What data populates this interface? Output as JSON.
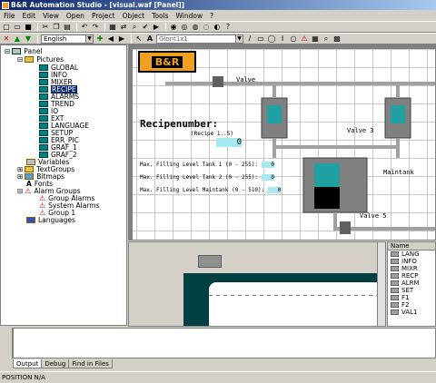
{
  "window": {
    "title": "B&R Automation Studio - [visual.waf [Panel]]"
  },
  "menu": [
    "File",
    "Edit",
    "View",
    "Open",
    "Project",
    "Object",
    "Tools",
    "Window",
    "?"
  ],
  "toolbar2": {
    "language": "English",
    "font": "Glont1x1"
  },
  "tree": {
    "root": "Panel",
    "pictures_label": "Pictures",
    "pictures": [
      "GLOBAL",
      "INFO",
      "MIXER",
      "RECIPE",
      "ALARMS",
      "TREND",
      "IO",
      "EXT",
      "LANGUAGE",
      "SETUP",
      "ERR_PIC",
      "GRAF_1",
      "GRAF_2"
    ],
    "selected": "RECIPE",
    "variables": "Variables",
    "textgroups": "TextGroups",
    "bitmaps": "Bitmaps",
    "fonts": "Fonts",
    "alarm_groups": "Alarm Groups",
    "alarms": [
      "Group Alarms",
      "System Alarms",
      "Group 1"
    ],
    "languages": "Languages"
  },
  "editor": {
    "logo": "B&R",
    "valve_top": "Valve",
    "recipe_title": "Recipenumber:",
    "recipe_hint": "(Recipe 1..5)",
    "recipe_value": "0",
    "valve3": "Valve 3",
    "lines": [
      {
        "label": "Max. Filling Level Tank 1 (0 - 255):",
        "value": "0"
      },
      {
        "label": "Max. Filling Level Tank 2 (0 - 255):",
        "value": "0"
      },
      {
        "label": "Max. Filling Level Maintank (0 - 510):",
        "value": "0"
      }
    ],
    "maintank": "Maintank",
    "valve5": "Valve 5"
  },
  "namelist": {
    "header": "Name",
    "items": [
      "LANG",
      "INFO",
      "MIXR",
      "RECP",
      "ALRM",
      "SET",
      "F1",
      "F2",
      "VAL1"
    ]
  },
  "tabs": [
    "Output",
    "Debug",
    "Find in Files"
  ],
  "status": "POSITION N/A"
}
